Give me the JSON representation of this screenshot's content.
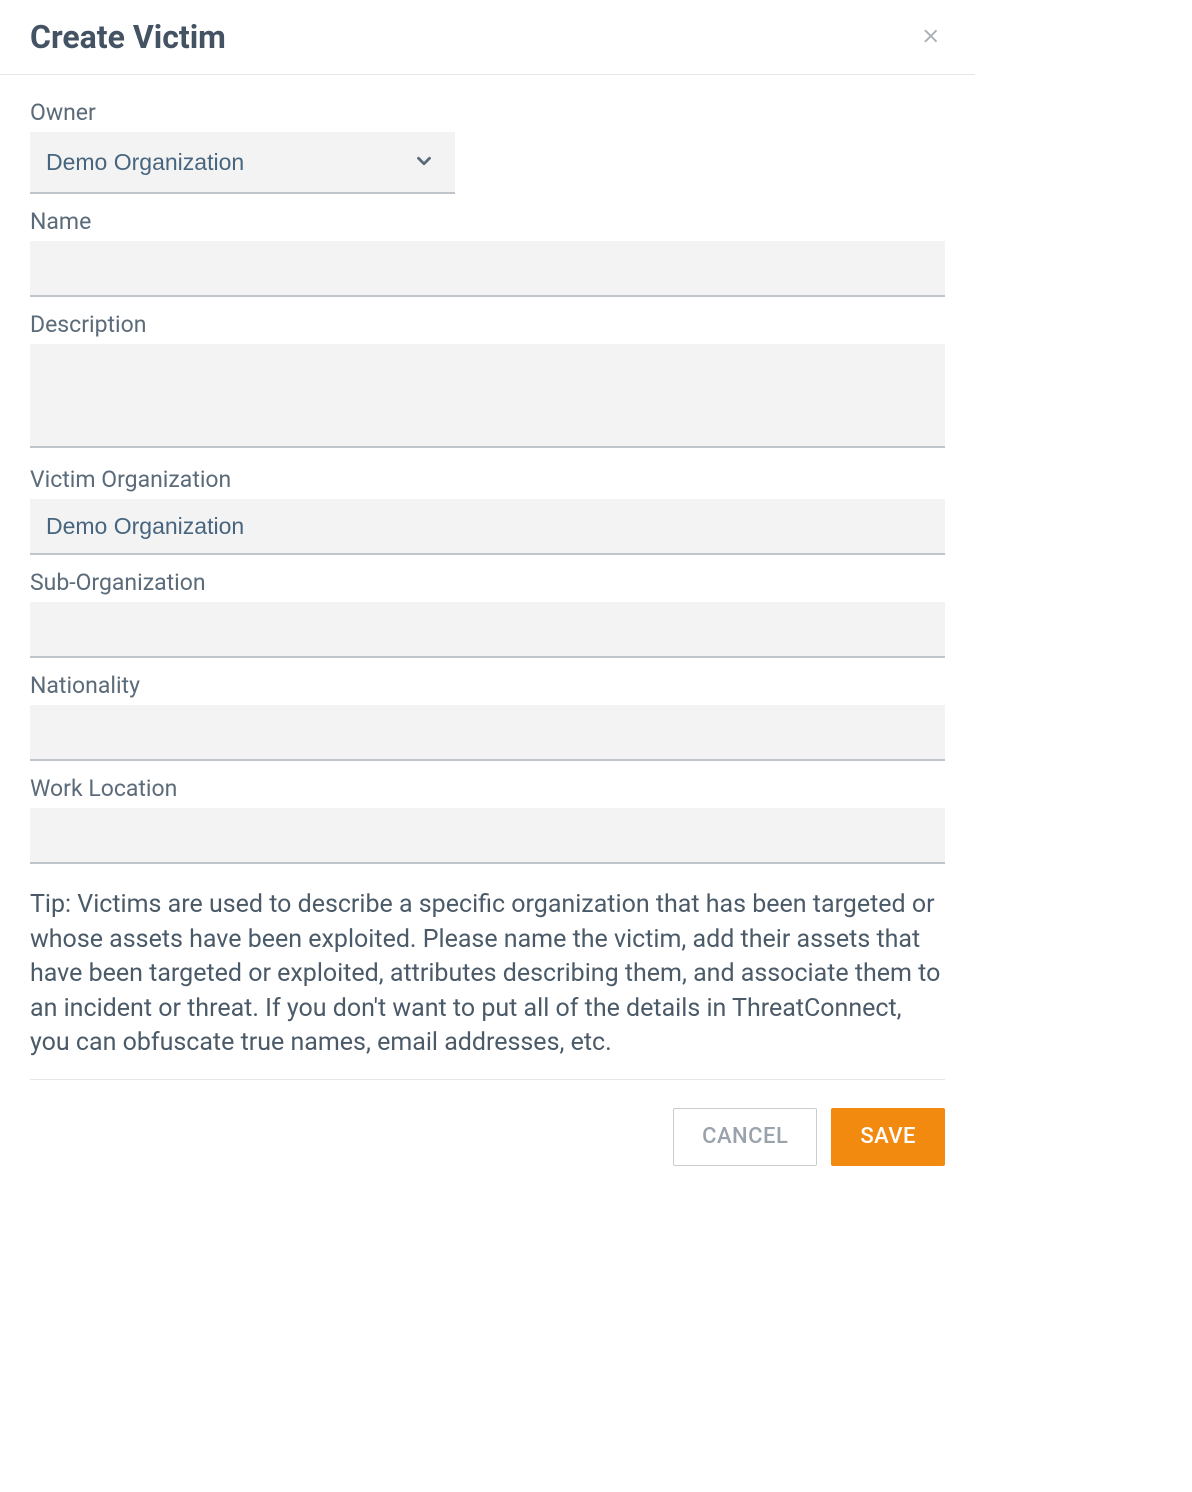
{
  "modal": {
    "title": "Create Victim",
    "fields": {
      "owner": {
        "label": "Owner",
        "value": "Demo Organization"
      },
      "name": {
        "label": "Name",
        "value": ""
      },
      "description": {
        "label": "Description",
        "value": ""
      },
      "victim_org": {
        "label": "Victim Organization",
        "value": "Demo Organization"
      },
      "sub_org": {
        "label": "Sub-Organization",
        "value": ""
      },
      "nationality": {
        "label": "Nationality",
        "value": ""
      },
      "work_location": {
        "label": "Work Location",
        "value": ""
      }
    },
    "tip": "Tip: Victims are used to describe a specific organization that has been targeted or whose assets have been exploited. Please name the victim, add their assets that have been targeted or exploited, attributes describing them, and associate them to an incident or threat. If you don't want to put all of the details in ThreatConnect, you can obfuscate true names, email addresses, etc.",
    "buttons": {
      "cancel": "CANCEL",
      "save": "SAVE"
    }
  },
  "colors": {
    "accent": "#f28a0f",
    "text_muted": "#5b6b79",
    "input_bg": "#f3f3f3"
  }
}
